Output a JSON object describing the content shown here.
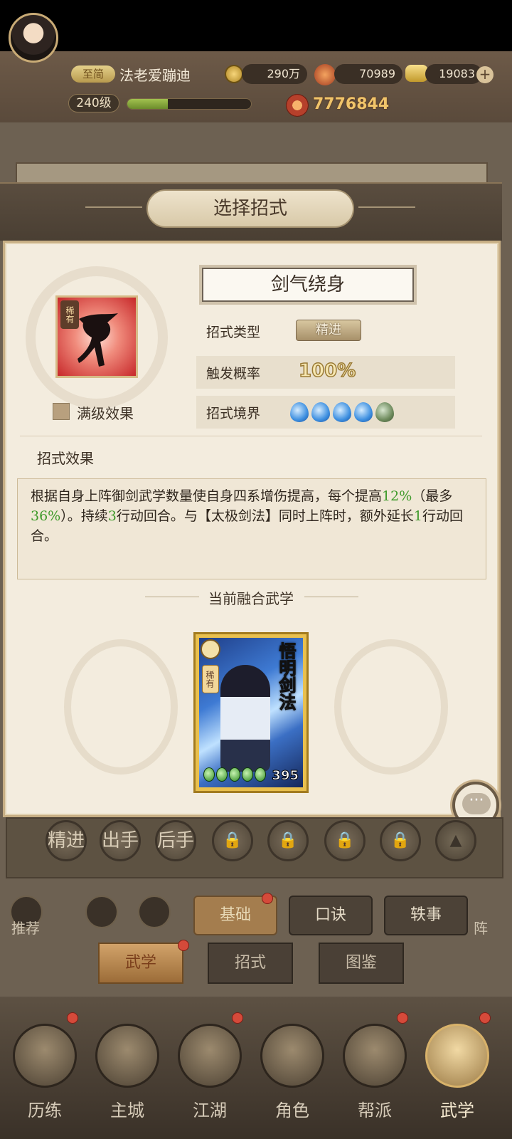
{
  "player": {
    "vip_label": "至简",
    "name": "法老爱蹦迪",
    "level": "240级",
    "xp_progress": 0.33,
    "coins": "290万",
    "tokens": "70989",
    "ingots": "19083",
    "power": "7776844"
  },
  "modal": {
    "title": "选择招式",
    "rarity": "稀有",
    "skill_name": "剑气绕身",
    "max_effect_label": "满级效果",
    "type_label": "招式类型",
    "type_value": "精进",
    "trigger_label": "触发概率",
    "trigger_value": "100%",
    "realm_label": "招式境界",
    "realm_filled": 4,
    "realm_total": 5,
    "effect_section_label": "招式效果",
    "effect_text": {
      "p1": "根据自身上阵御剑武学数量使自身四系增伤提高，每个提高",
      "v1": "12%",
      "p2": "（最多",
      "v2": "36%",
      "p3": "）。持续",
      "v3": "3",
      "p4": "行动回合。与【太极剑法】同时上阵时，额外延长",
      "v4": "1",
      "p5": "行动回合。"
    },
    "fused_label": "当前融合武学",
    "card": {
      "name": "悟明剑法",
      "rarity": "稀有",
      "stars": 5,
      "number": "395"
    }
  },
  "skill_buttons": [
    "精进",
    "出手",
    "后手",
    "",
    "",
    "",
    "",
    ""
  ],
  "sub_tabs": {
    "left_label": "推荐",
    "right_label": "阵",
    "basic": "基础",
    "formula": "口诀",
    "anecdote": "轶事"
  },
  "main_tabs": {
    "martial": "武学",
    "moves": "招式",
    "catalog": "图鉴"
  },
  "bottom_nav": [
    {
      "label": "历练"
    },
    {
      "label": "主城"
    },
    {
      "label": "江湖"
    },
    {
      "label": "角色"
    },
    {
      "label": "帮派"
    },
    {
      "label": "武学"
    }
  ],
  "colors": {
    "highlight_green": "#3e9a2a",
    "realm_blue": "#3d8fe0",
    "realm_empty": "#6d8a5c",
    "notification_red": "#d54a3a"
  }
}
